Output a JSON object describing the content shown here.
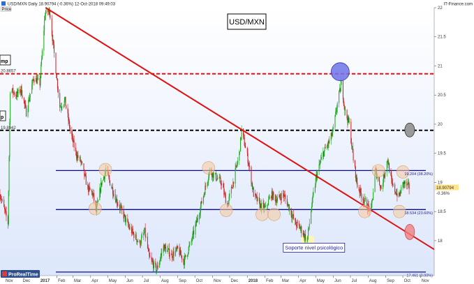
{
  "header": {
    "symbol_line": "USD/MXN   Daily   18.90794 (-0.36%)   12-Oct-2018 09:49:03",
    "source": "IT-Finance.com",
    "price_tag": "Price"
  },
  "brand": {
    "label": "ProRealTime"
  },
  "edge_labels": {
    "left_upper": "mp",
    "left_lower": "p"
  },
  "colors": {
    "bull_candle": "#19a619",
    "bear_candle": "#c81e1e",
    "trendline": "#e01010",
    "resistance_dashed": "#e01010",
    "support_dashed": "#000000",
    "fib_lines": "#0a0a9a",
    "plot_bg_top": "#ffffff",
    "plot_bg_bottom": "#dde7fb"
  },
  "chart_data": {
    "type": "candlestick",
    "title": "USD/MXN",
    "ylim": [
      17.4,
      22.0
    ],
    "y_ticks": [
      "22",
      "21.5",
      "21",
      "20.5",
      "20",
      "19.5",
      "19",
      "18.5",
      "18"
    ],
    "x_range": [
      "2016-10-24",
      "2018-11-25"
    ],
    "x_ticks": [
      {
        "label": "Nov",
        "date": "2016-11-01"
      },
      {
        "label": "Dec",
        "date": "2016-12-01"
      },
      {
        "label": "2017",
        "date": "2017-01-01",
        "bold": true
      },
      {
        "label": "Feb",
        "date": "2017-02-01"
      },
      {
        "label": "Mar",
        "date": "2017-03-01"
      },
      {
        "label": "Apr",
        "date": "2017-04-01"
      },
      {
        "label": "May",
        "date": "2017-05-01"
      },
      {
        "label": "Jun",
        "date": "2017-06-01"
      },
      {
        "label": "Jul",
        "date": "2017-07-01"
      },
      {
        "label": "Aug",
        "date": "2017-08-01"
      },
      {
        "label": "Sep",
        "date": "2017-09-01"
      },
      {
        "label": "Oct",
        "date": "2017-10-01"
      },
      {
        "label": "Nov",
        "date": "2017-11-01"
      },
      {
        "label": "Dec",
        "date": "2017-12-01"
      },
      {
        "label": "2018",
        "date": "2018-01-01",
        "bold": true
      },
      {
        "label": "Feb",
        "date": "2018-02-01"
      },
      {
        "label": "Mar",
        "date": "2018-03-01"
      },
      {
        "label": "Apr",
        "date": "2018-04-01"
      },
      {
        "label": "May",
        "date": "2018-05-01"
      },
      {
        "label": "Jun",
        "date": "2018-06-01"
      },
      {
        "label": "Jul",
        "date": "2018-07-01"
      },
      {
        "label": "Aug",
        "date": "2018-08-01"
      },
      {
        "label": "Sep",
        "date": "2018-09-01"
      },
      {
        "label": "Oct",
        "date": "2018-10-01"
      },
      {
        "label": "Nov",
        "date": "2018-11-01"
      }
    ],
    "price_path": [
      [
        "2016-10-24",
        18.8
      ],
      [
        "2016-11-07",
        18.3
      ],
      [
        "2016-11-11",
        20.6
      ],
      [
        "2016-11-22",
        20.5
      ],
      [
        "2016-11-30",
        20.6
      ],
      [
        "2016-12-09",
        20.2
      ],
      [
        "2016-12-22",
        20.8
      ],
      [
        "2017-01-02",
        20.7
      ],
      [
        "2017-01-11",
        21.9
      ],
      [
        "2017-01-19",
        21.95
      ],
      [
        "2017-01-26",
        21.3
      ],
      [
        "2017-02-06",
        20.3
      ],
      [
        "2017-02-15",
        20.4
      ],
      [
        "2017-02-24",
        19.9
      ],
      [
        "2017-03-06",
        19.5
      ],
      [
        "2017-03-15",
        19.35
      ],
      [
        "2017-03-27",
        18.9
      ],
      [
        "2017-04-05",
        18.8
      ],
      [
        "2017-04-11",
        18.5
      ],
      [
        "2017-04-20",
        19.0
      ],
      [
        "2017-04-28",
        19.2
      ],
      [
        "2017-05-05",
        19.0
      ],
      [
        "2017-05-16",
        18.7
      ],
      [
        "2017-05-26",
        18.5
      ],
      [
        "2017-06-06",
        18.25
      ],
      [
        "2017-06-16",
        18.1
      ],
      [
        "2017-06-26",
        17.95
      ],
      [
        "2017-07-05",
        18.15
      ],
      [
        "2017-07-13",
        17.7
      ],
      [
        "2017-07-26",
        17.5
      ],
      [
        "2017-08-07",
        17.9
      ],
      [
        "2017-08-21",
        17.75
      ],
      [
        "2017-09-01",
        17.85
      ],
      [
        "2017-09-12",
        17.65
      ],
      [
        "2017-09-25",
        18.0
      ],
      [
        "2017-10-09",
        18.5
      ],
      [
        "2017-10-19",
        18.9
      ],
      [
        "2017-10-27",
        19.2
      ],
      [
        "2017-11-06",
        19.1
      ],
      [
        "2017-11-16",
        19.0
      ],
      [
        "2017-11-27",
        18.6
      ],
      [
        "2017-12-07",
        19.0
      ],
      [
        "2017-12-18",
        19.5
      ],
      [
        "2017-12-22",
        19.9
      ],
      [
        "2018-01-02",
        19.4
      ],
      [
        "2018-01-12",
        18.8
      ],
      [
        "2018-01-24",
        18.6
      ],
      [
        "2018-02-02",
        18.55
      ],
      [
        "2018-02-12",
        18.8
      ],
      [
        "2018-02-22",
        18.7
      ],
      [
        "2018-03-05",
        18.8
      ],
      [
        "2018-03-14",
        18.6
      ],
      [
        "2018-03-26",
        18.3
      ],
      [
        "2018-04-05",
        18.2
      ],
      [
        "2018-04-16",
        18.0
      ],
      [
        "2018-04-24",
        18.6
      ],
      [
        "2018-05-02",
        19.1
      ],
      [
        "2018-05-14",
        19.5
      ],
      [
        "2018-05-25",
        19.7
      ],
      [
        "2018-06-01",
        19.9
      ],
      [
        "2018-06-07",
        20.3
      ],
      [
        "2018-06-15",
        20.7
      ],
      [
        "2018-06-22",
        20.2
      ],
      [
        "2018-06-29",
        20.0
      ],
      [
        "2018-07-06",
        19.4
      ],
      [
        "2018-07-13",
        18.95
      ],
      [
        "2018-07-24",
        18.7
      ],
      [
        "2018-08-06",
        18.5
      ],
      [
        "2018-08-14",
        19.2
      ],
      [
        "2018-08-24",
        18.9
      ],
      [
        "2018-09-04",
        19.4
      ],
      [
        "2018-09-12",
        18.95
      ],
      [
        "2018-09-24",
        18.75
      ],
      [
        "2018-10-02",
        19.0
      ],
      [
        "2018-10-12",
        18.91
      ]
    ],
    "levels": [
      {
        "name": "dashed-resistance",
        "value": 20.8657,
        "style": "dashed",
        "color": "#e01010",
        "label": "20.8657",
        "label_side": "left"
      },
      {
        "name": "dashed-support",
        "value": 19.8942,
        "style": "dashed",
        "color": "#000000",
        "label": "19.8942",
        "label_side": "left"
      },
      {
        "name": "fib-38",
        "value": 19.204,
        "style": "solid",
        "color": "#0a0a9a",
        "label": "19.204 (38.20%)",
        "label_side": "right"
      },
      {
        "name": "fib-23",
        "value": 18.534,
        "style": "solid",
        "color": "#0a0a9a",
        "label": "18.534 (23.60%)",
        "label_side": "right"
      },
      {
        "name": "fib-0",
        "value": 17.461,
        "style": "solid",
        "color": "#0a0a9a",
        "label": "17.461 (0.00%)",
        "label_side": "right"
      }
    ],
    "trendline": {
      "from": [
        "2017-01-12",
        22.0
      ],
      "to": [
        "2018-11-25",
        17.85
      ]
    },
    "last_price": {
      "value": 18.90794,
      "label": "18.90794",
      "change": "-0.36%"
    },
    "annotations": [
      {
        "text": "Soporte nivel psicológico",
        "date": "2018-04-28",
        "value": 17.88,
        "box": true
      }
    ],
    "circles": [
      {
        "date": "2017-04-09",
        "value": 18.55,
        "kind": "touch"
      },
      {
        "date": "2017-04-27",
        "value": 19.22,
        "kind": "touch"
      },
      {
        "date": "2017-10-25",
        "value": 19.25,
        "kind": "touch"
      },
      {
        "date": "2017-11-25",
        "value": 18.52,
        "kind": "touch"
      },
      {
        "date": "2018-01-27",
        "value": 18.45,
        "kind": "touch"
      },
      {
        "date": "2018-02-17",
        "value": 18.45,
        "kind": "touch"
      },
      {
        "date": "2018-07-26",
        "value": 18.5,
        "kind": "touch"
      },
      {
        "date": "2018-08-19",
        "value": 19.2,
        "kind": "touch"
      },
      {
        "date": "2018-09-25",
        "value": 18.5,
        "kind": "touch"
      },
      {
        "date": "2018-10-01",
        "value": 19.18,
        "kind": "touch"
      },
      {
        "date": "2018-06-13",
        "value": 20.9,
        "kind": "top"
      },
      {
        "date": "2018-10-13",
        "value": 19.9,
        "kind": "gray"
      },
      {
        "date": "2018-10-13",
        "value": 18.15,
        "kind": "red"
      }
    ],
    "highlights": [
      {
        "date_from": "2018-04-05",
        "date_to": "2018-04-28",
        "value_from": 17.85,
        "value_to": 18.08
      }
    ],
    "grid": false
  }
}
